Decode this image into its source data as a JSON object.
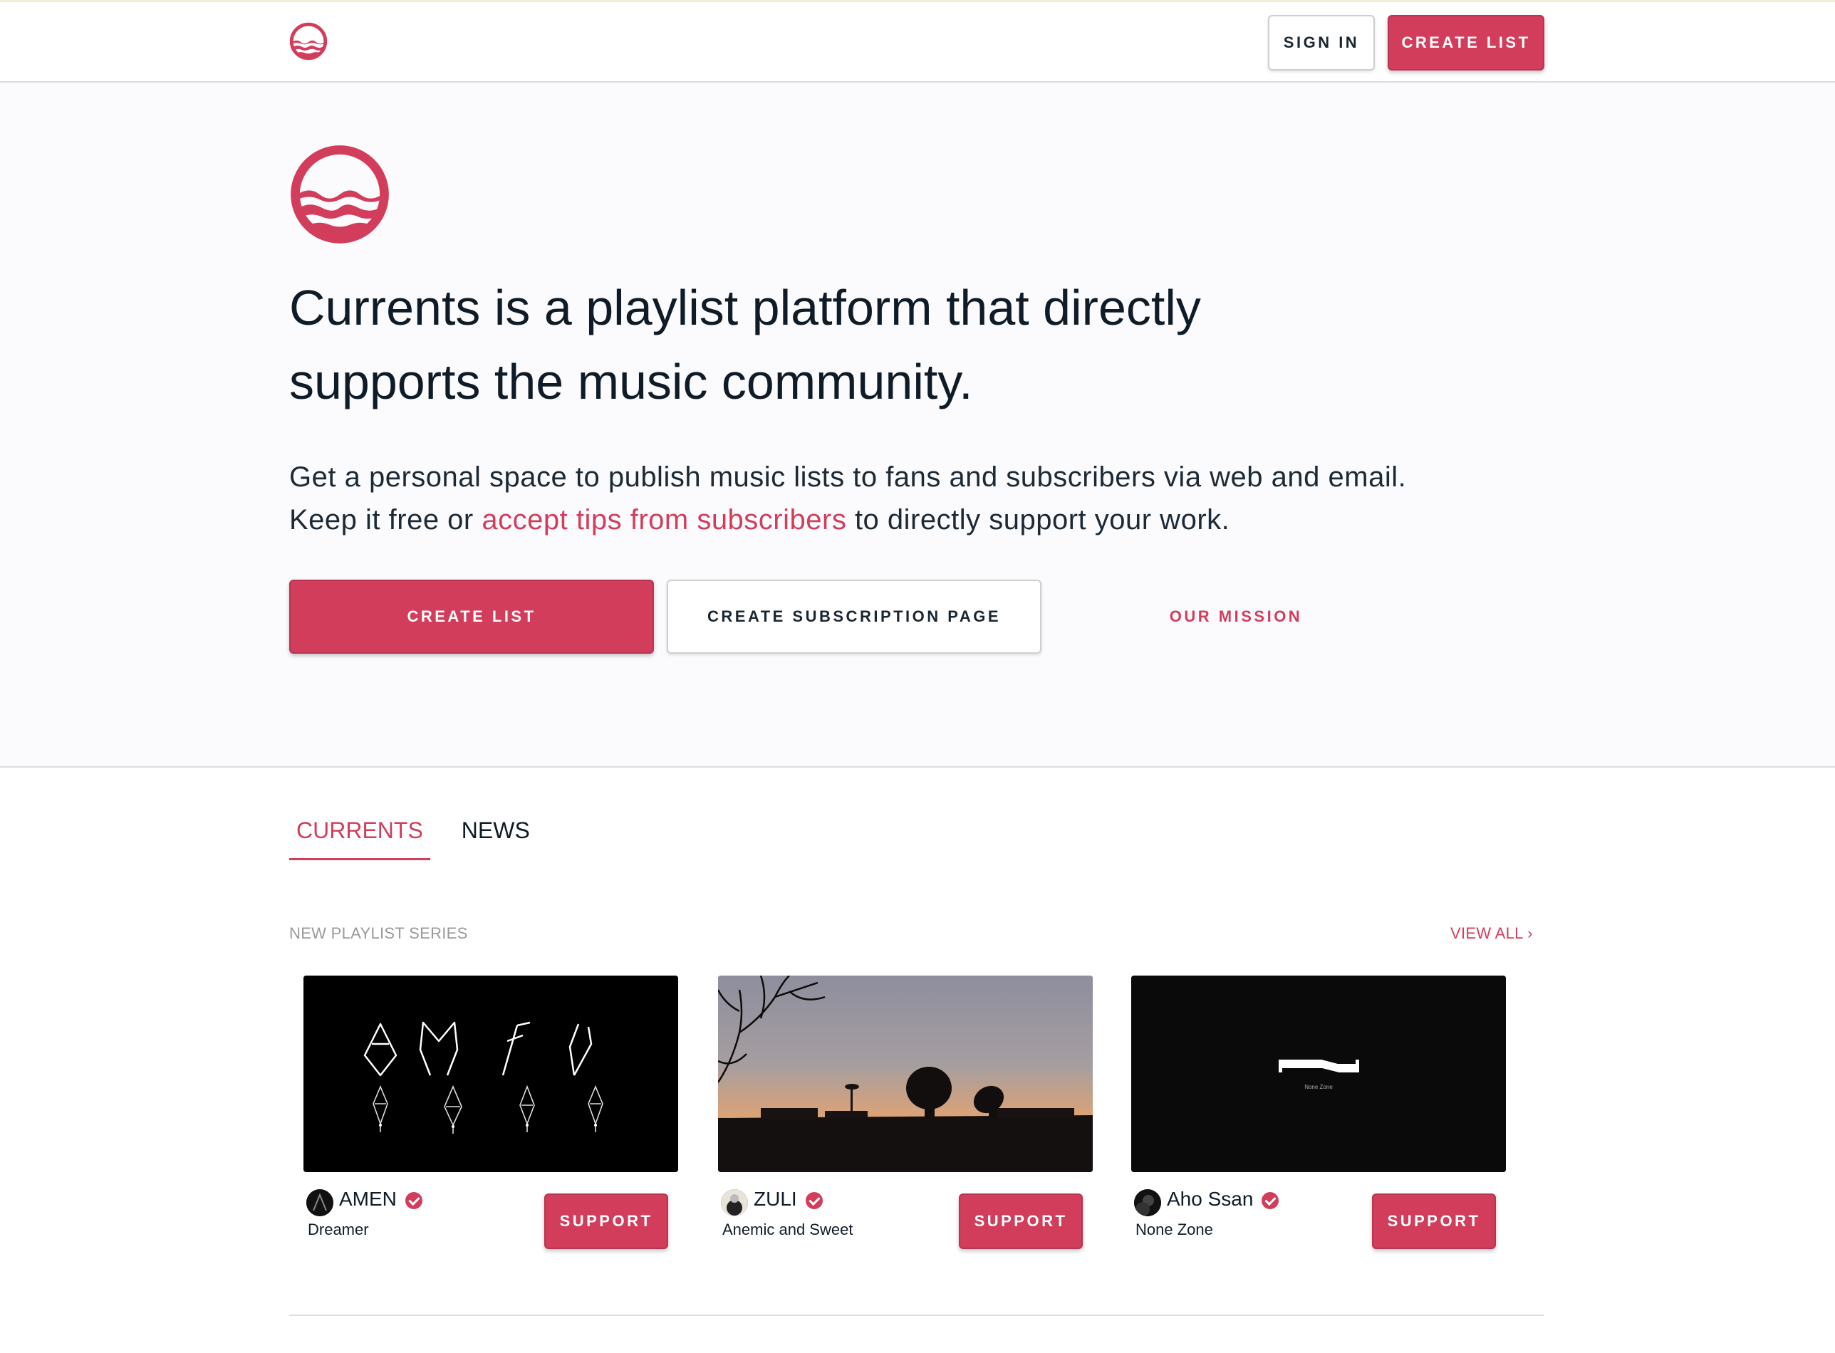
{
  "nav": {
    "logo_icon": "currents-wave-logo-icon",
    "sign_in_label": "SIGN IN",
    "create_list_label": "CREATE LIST"
  },
  "hero": {
    "logo_icon": "currents-wave-logo-icon",
    "title": "Currents is a playlist platform that directly supports the music community.",
    "desc_part1": "Get a personal space to publish music lists to fans and subscribers via web and email. Keep it free or ",
    "desc_link": "accept tips from subscribers",
    "desc_part2": " to directly support your work.",
    "create_list_label": "CREATE LIST",
    "create_subscription_label": "CREATE SUBSCRIPTION PAGE",
    "mission_label": "OUR MISSION"
  },
  "tabs": [
    {
      "label": "CURRENTS",
      "active": true
    },
    {
      "label": "NEWS",
      "active": false
    }
  ],
  "section": {
    "label": "NEW PLAYLIST SERIES",
    "view_all_label": "VIEW ALL ›"
  },
  "cards": [
    {
      "artist": "AMEN",
      "series": "Dreamer",
      "support_label": "SUPPORT",
      "verified": true
    },
    {
      "artist": "ZULI",
      "series": "Anemic and Sweet",
      "support_label": "SUPPORT",
      "verified": true
    },
    {
      "artist": "Aho Ssan",
      "series": "None Zone",
      "support_label": "SUPPORT",
      "verified": true,
      "cover_caption": "None Zone"
    }
  ],
  "colors": {
    "accent": "#d23d5c",
    "text": "#0f1c28",
    "muted": "#9a9a9a",
    "hero_bg": "#fbfbfd"
  }
}
